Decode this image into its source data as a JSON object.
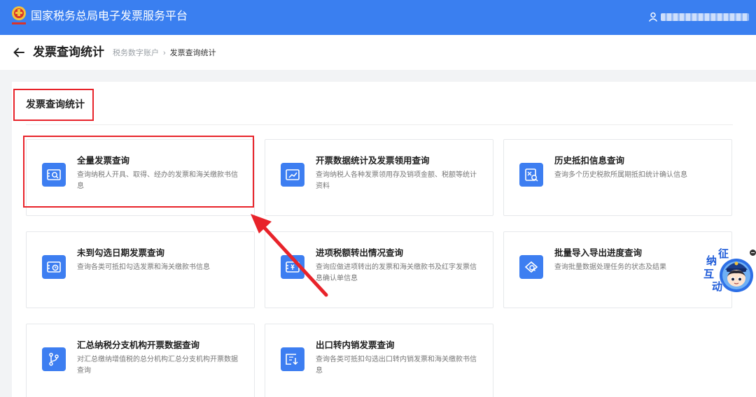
{
  "header": {
    "title": "国家税务总局电子发票服务平台",
    "logo_icon": "tax-emblem-icon",
    "user_icon": "user-icon"
  },
  "subheader": {
    "title": "发票查询统计",
    "breadcrumb": [
      "税务数字账户",
      "发票查询统计"
    ],
    "back_icon": "arrow-left-icon"
  },
  "section": {
    "title": "发票查询统计"
  },
  "cards": [
    {
      "title": "全量发票查询",
      "desc": "查询纳税人开具、取得、经办的发票和海关缴款书信息",
      "icon": "invoice-search-icon"
    },
    {
      "title": "开票数据统计及发票领用查询",
      "desc": "查询纳税人各种发票领用存及销项金额、税额等统计资料",
      "icon": "invoice-chart-icon"
    },
    {
      "title": "历史抵扣信息查询",
      "desc": "查询多个历史税款所属期抵扣统计确认信息",
      "icon": "history-search-icon"
    },
    {
      "title": "未到勾选日期发票查询",
      "desc": "查询各类可抵扣勾选发票和海关缴款书信息",
      "icon": "invoice-clock-icon"
    },
    {
      "title": "进项税额转出情况查询",
      "desc": "查询应做进项转出的发票和海关缴款书及红字发票信息确认单信息",
      "icon": "invoice-yuan-icon"
    },
    {
      "title": "批量导入导出进度查询",
      "desc": "查询批量数据处理任务的状态及结果",
      "icon": "batch-progress-icon"
    },
    {
      "title": "汇总纳税分支机构开票数据查询",
      "desc": "对汇总缴纳增值税的总分机构汇总分支机构开票数据查询",
      "icon": "branch-icon"
    },
    {
      "title": "出口转内销发票查询",
      "desc": "查询各类可抵扣勾选出口转内销发票和海关缴款书信息",
      "icon": "invoice-export-icon"
    }
  ],
  "float_widget": {
    "chars": [
      "征",
      "纳",
      "互",
      "动"
    ],
    "icon": "mascot-avatar-icon"
  },
  "colors": {
    "primary": "#3a7ff0",
    "annotation": "#e8232a"
  }
}
